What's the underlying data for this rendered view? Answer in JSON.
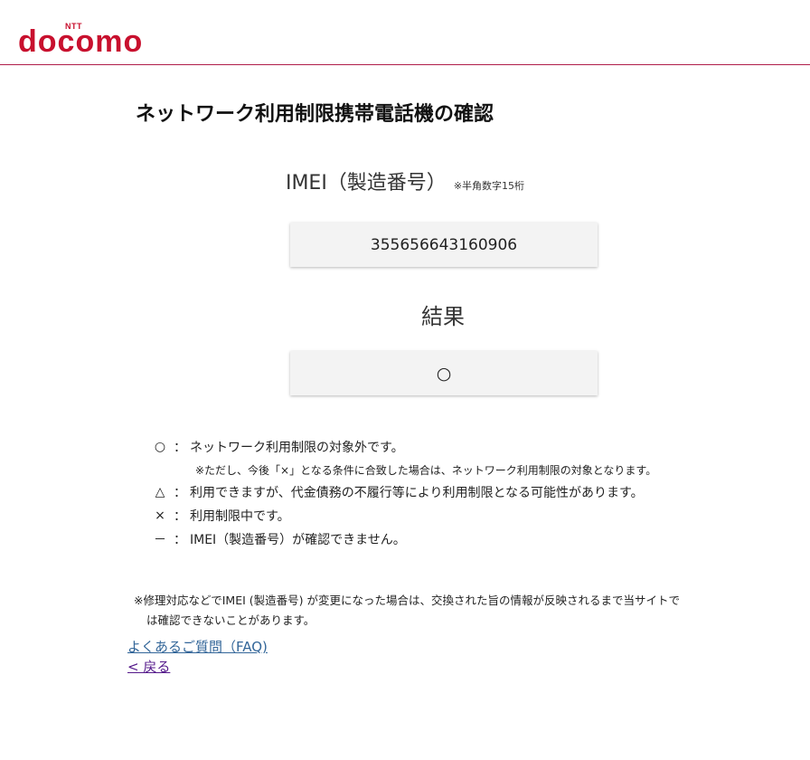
{
  "header": {
    "logo_ntt": "NTT",
    "logo_text": "docomo",
    "brand_color": "#c8102e"
  },
  "page_title": "ネットワーク利用制限携帯電話機の確認",
  "imei": {
    "label": "IMEI（製造番号）",
    "note": "※半角数字15桁",
    "value": "355656643160906"
  },
  "result": {
    "label": "結果",
    "value": "○"
  },
  "legend": {
    "items": [
      {
        "symbol": "○",
        "sep": "：",
        "text": "ネットワーク利用制限の対象外です。"
      },
      {
        "symbol": "△",
        "sep": "：",
        "text": "利用できますが、代金債務の不履行等により利用制限となる可能性があります。"
      },
      {
        "symbol": "×",
        "sep": "：",
        "text": "利用制限中です。"
      },
      {
        "symbol": "－",
        "sep": "：",
        "text": "IMEI（製造番号）が確認できません。"
      }
    ],
    "sub_note": "※ただし、今後「×」となる条件に合致した場合は、ネットワーク利用制限の対象となります。"
  },
  "footnote": {
    "line1": "※修理対応などでIMEI (製造番号) が変更になった場合は、交換された旨の情報が反映されるまで当サイトで",
    "line2": "は確認できないことがあります。"
  },
  "links": {
    "faq": "よくあるご質問（FAQ)",
    "back": "< 戻る"
  }
}
